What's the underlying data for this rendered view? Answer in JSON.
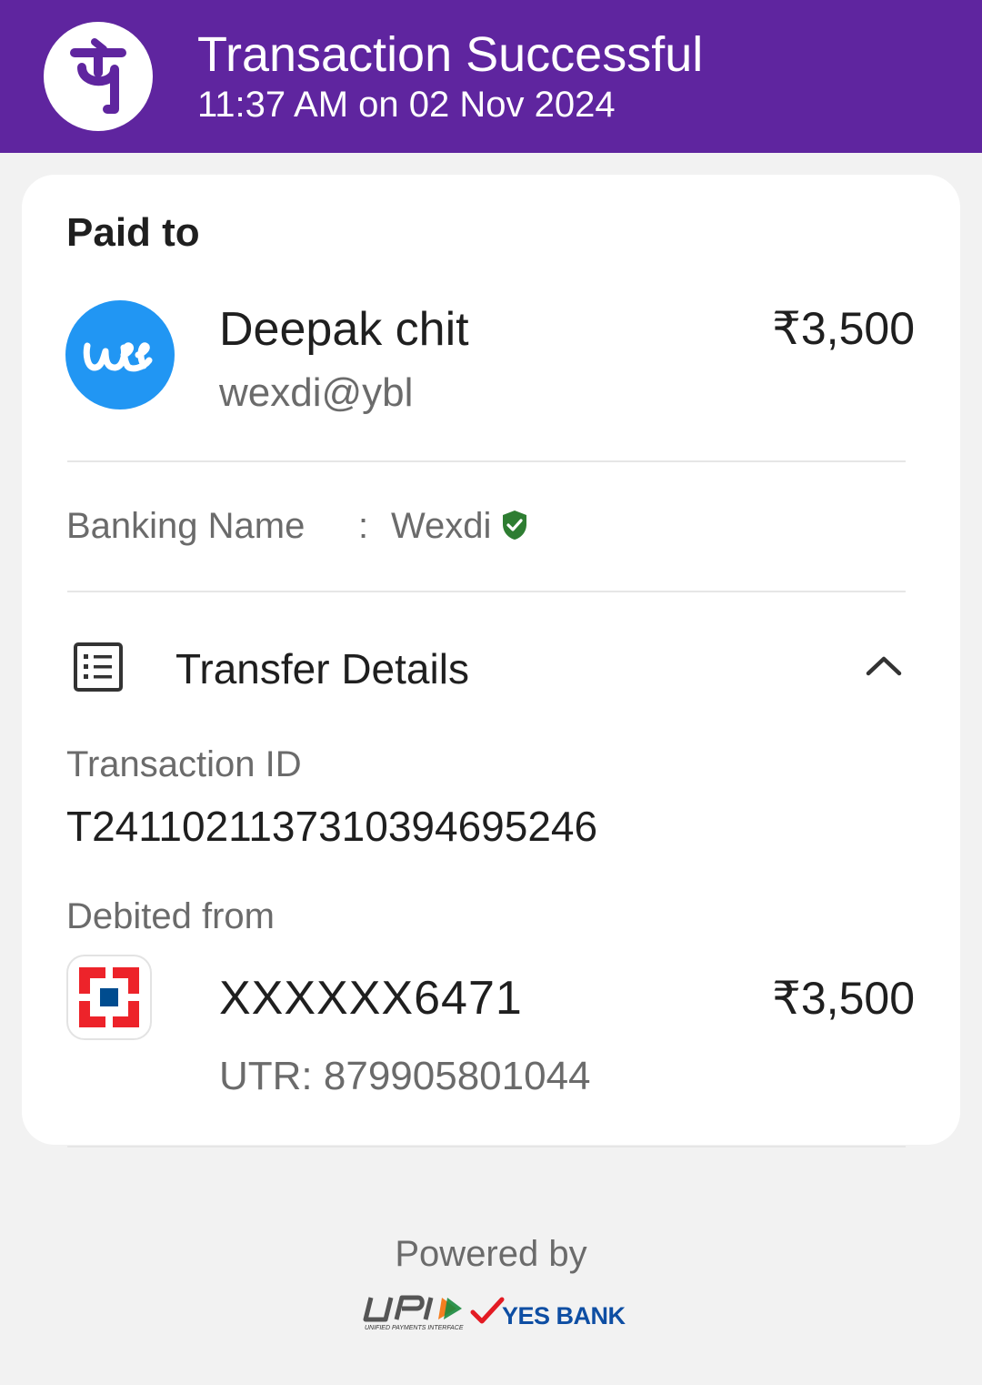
{
  "header": {
    "logo_icon": "phonepe-logo-icon",
    "title": "Transaction Successful",
    "subtitle": "11:37 AM on 02 Nov 2024",
    "background_color": "#5f259f"
  },
  "payment": {
    "section_label": "Paid to",
    "payee_avatar_icon": "payee-avatar-icon",
    "payee_name": "Deepak chit",
    "payee_upi": "wexdi@ybl",
    "amount": "₹3,500"
  },
  "banking": {
    "label": "Banking Name",
    "separator": ":",
    "value": "Wexdi",
    "verified_icon": "verified-shield-icon",
    "verified_color": "#2e7d32"
  },
  "transfer_details": {
    "icon": "receipt-list-icon",
    "title": "Transfer Details",
    "toggle_icon": "chevron-up-icon",
    "transaction_id_label": "Transaction ID",
    "transaction_id": "T2411021137310394695246",
    "debited_from_label": "Debited from",
    "bank_icon": "hdfc-bank-logo-icon",
    "account_number": "XXXXXX6471",
    "debit_amount": "₹3,500",
    "utr": "UTR: 879905801044"
  },
  "footer": {
    "powered_by": "Powered by",
    "upi_logo": "upi-logo",
    "upi_caption": "UNIFIED PAYMENTS INTERFACE",
    "bank_partner": "YES BANK",
    "bank_partner_color": "#0e4ea3"
  }
}
